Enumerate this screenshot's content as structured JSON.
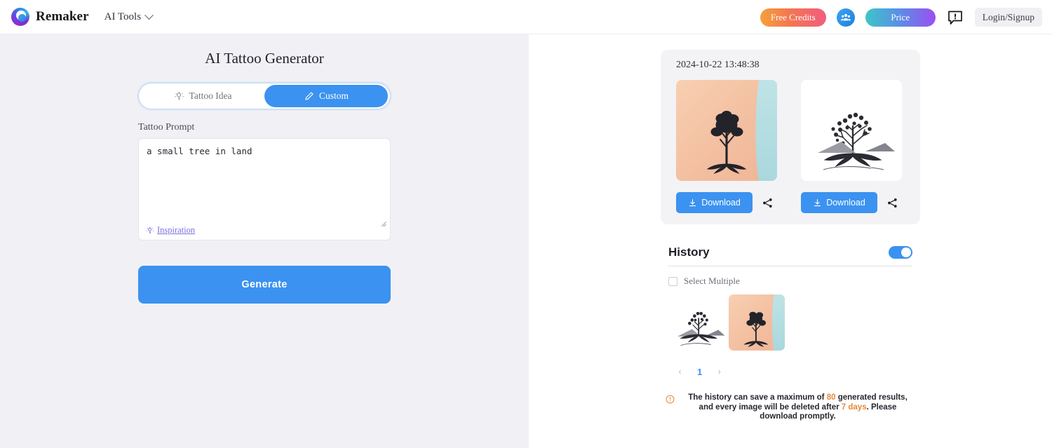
{
  "header": {
    "brand_name": "Remaker",
    "nav_label": "AI Tools",
    "free_credits_label": "Free Credits",
    "price_label": "Price",
    "login_label": "Login/Signup",
    "accent_blue": "#3b92f0"
  },
  "left": {
    "title": "AI Tattoo Generator",
    "tabs": [
      {
        "label": "Tattoo Idea",
        "active": false
      },
      {
        "label": "Custom",
        "active": true
      }
    ],
    "prompt_label": "Tattoo Prompt",
    "prompt_value": "a small tree in land",
    "prompt_placeholder": "",
    "inspiration_label": "Inspiration",
    "generate_label": "Generate"
  },
  "right": {
    "result": {
      "timestamp": "2024-10-22 13:48:38",
      "download_label_1": "Download",
      "download_label_2": "Download"
    },
    "history": {
      "title": "History",
      "toggle_on": true,
      "select_multiple_label": "Select Multiple",
      "pagination": {
        "prev": "‹",
        "current": "1",
        "next": "›"
      }
    },
    "notice": {
      "text_part_1": "The history can save a maximum of ",
      "max_results": "80",
      "text_part_2": " generated results, and every image will be deleted after ",
      "retention": "7 days",
      "text_part_3": ". Please download promptly.",
      "highlight_color": "#e8883a"
    }
  }
}
